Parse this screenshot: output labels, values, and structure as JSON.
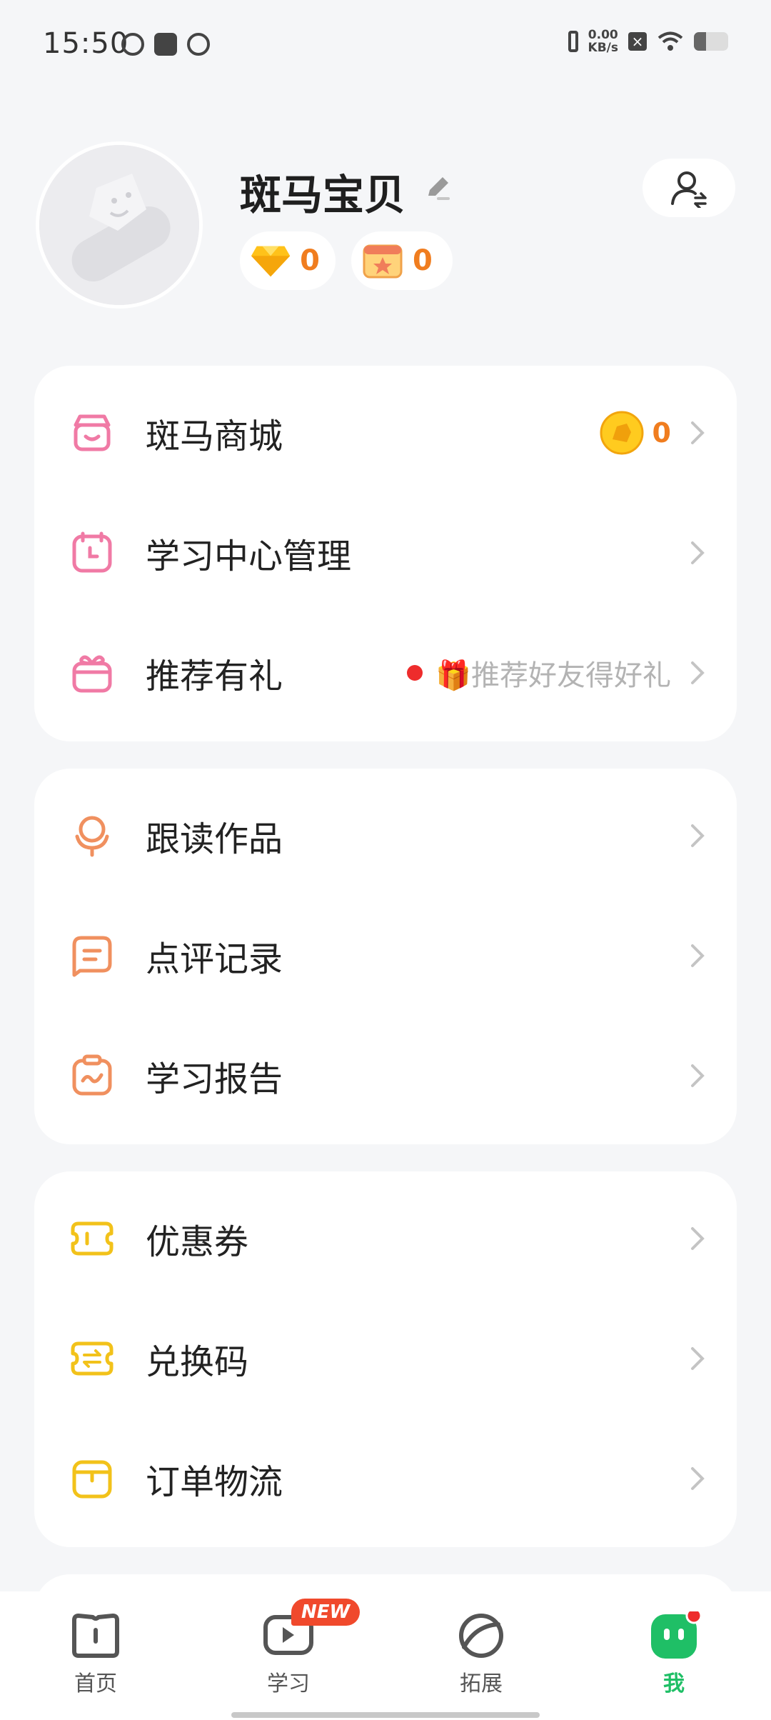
{
  "status_bar": {
    "time": "15:50",
    "net_speed_value": "0.00",
    "net_speed_unit": "KB/s"
  },
  "profile": {
    "nickname": "斑马宝贝",
    "diamonds": "0",
    "gift_boxes": "0"
  },
  "groups": [
    {
      "items": [
        {
          "label": "斑马商城",
          "icon": "shop-icon",
          "color": "#f07aa5",
          "coins": "0"
        },
        {
          "label": "学习中心管理",
          "icon": "calendar-clock-icon",
          "color": "#f07aa5"
        },
        {
          "label": "推荐有礼",
          "icon": "gift-icon",
          "color": "#f07aa5",
          "hint": "🎁推荐好友得好礼"
        }
      ]
    },
    {
      "items": [
        {
          "label": "跟读作品",
          "icon": "microphone-icon",
          "color": "#f0905f"
        },
        {
          "label": "点评记录",
          "icon": "comment-icon",
          "color": "#f0905f"
        },
        {
          "label": "学习报告",
          "icon": "report-icon",
          "color": "#f0905f"
        }
      ]
    },
    {
      "items": [
        {
          "label": "优惠券",
          "icon": "coupon-icon",
          "color": "#f2c21a"
        },
        {
          "label": "兑换码",
          "icon": "exchange-icon",
          "color": "#f2c21a"
        },
        {
          "label": "订单物流",
          "icon": "package-icon",
          "color": "#f2c21a"
        }
      ]
    }
  ],
  "bottom_nav": {
    "items": [
      {
        "label": "首页"
      },
      {
        "label": "学习",
        "badge": "NEW"
      },
      {
        "label": "拓展"
      },
      {
        "label": "我",
        "active": true
      }
    ]
  },
  "colors": {
    "accent_green": "#1fbf66",
    "orange_number": "#f07d1f",
    "badge_red": "#f0492c"
  }
}
